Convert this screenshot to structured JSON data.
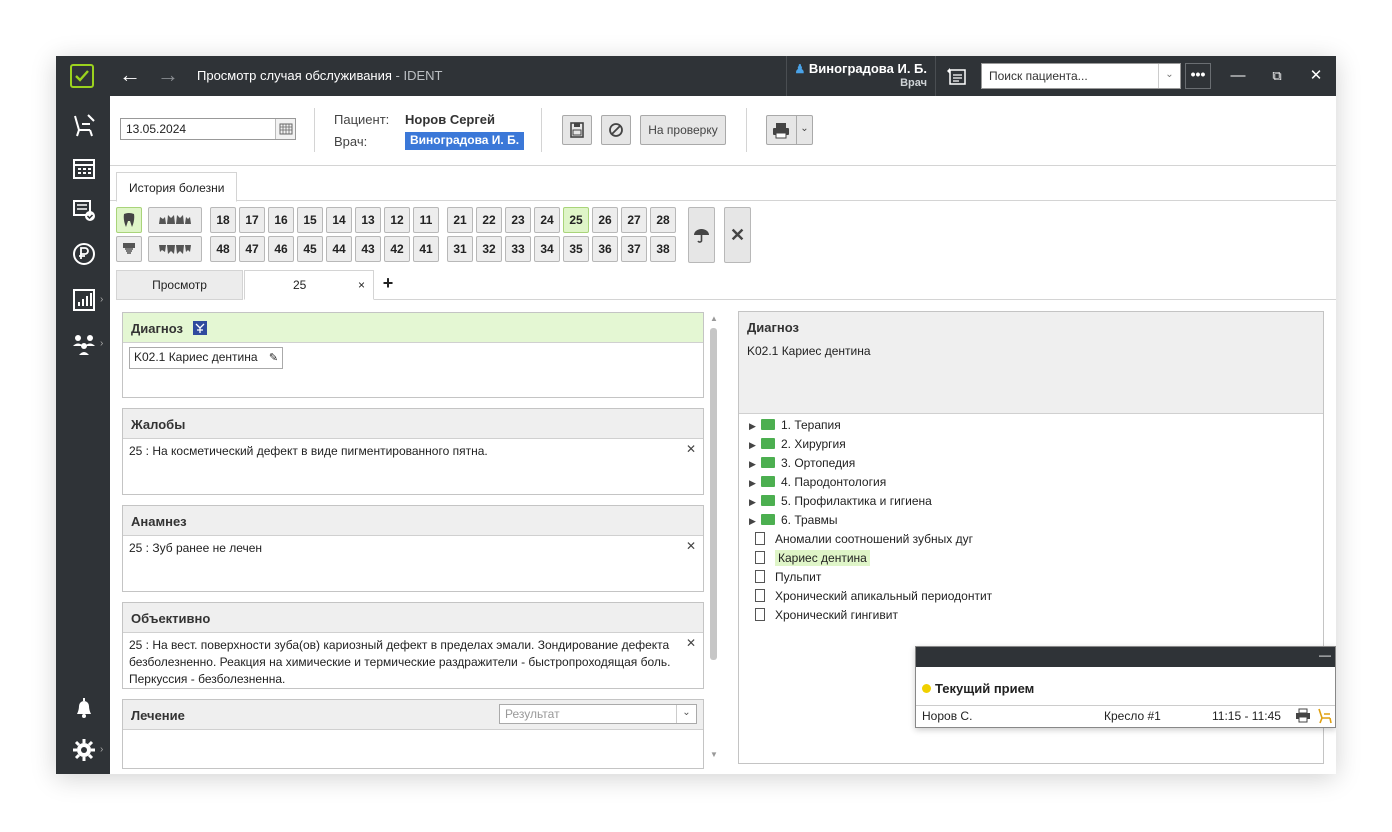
{
  "titlebar": {
    "page_title": "Просмотр случая обслуживания",
    "app_suffix": "- IDENT",
    "user_name": "Виноградова И. Б.",
    "user_role": "Врач",
    "search_placeholder": "Поиск пациента...",
    "more": "•••"
  },
  "toolbar": {
    "date": "13.05.2024",
    "patient_label": "Пациент:",
    "patient_name": "Норов Сергей",
    "doctor_label": "Врач:",
    "doctor_name": "Виноградова И. Б.",
    "review_label": "На проверку"
  },
  "tabs": {
    "history": "История болезни",
    "view": "Просмотр",
    "tooth_tab": "25",
    "close": "×",
    "add": "+"
  },
  "teeth": {
    "upper": [
      "18",
      "17",
      "16",
      "15",
      "14",
      "13",
      "12",
      "11",
      "21",
      "22",
      "23",
      "24",
      "25",
      "26",
      "27",
      "28"
    ],
    "lower": [
      "48",
      "47",
      "46",
      "45",
      "44",
      "43",
      "42",
      "41",
      "31",
      "32",
      "33",
      "34",
      "35",
      "36",
      "37",
      "38"
    ],
    "active": "25"
  },
  "panels": {
    "diagnosis": {
      "title": "Диагноз",
      "chip": "K02.1 Кариес дентина"
    },
    "complaints": {
      "title": "Жалобы",
      "text": "25 : На косметический дефект в виде пигментированного пятна."
    },
    "anamnesis": {
      "title": "Анамнез",
      "text": "25 : Зуб ранее не лечен"
    },
    "objective": {
      "title": "Объективно",
      "text": "25 : На вест. поверхности зуба(ов) кариозный дефект в пределах эмали. Зондирование дефекта безболезненно. Реакция на химические и термические раздражители - быстропроходящая боль. Перкуссия - безболезненна."
    },
    "treatment": {
      "title": "Лечение",
      "result_placeholder": "Результат"
    }
  },
  "right": {
    "title": "Диагноз",
    "value": "K02.1 Кариес дентина",
    "folders": [
      "1. Терапия",
      "2. Хирургия",
      "3. Ортопедия",
      "4. Пародонтология",
      "5. Профилактика и гигиена",
      "6. Травмы"
    ],
    "items": [
      "Аномалии соотношений зубных дуг",
      "Кариес дентина",
      "Пульпит",
      "Хронический апикальный периодонтит",
      "Хронический гингивит"
    ],
    "selected": "Кариес дентина"
  },
  "popup": {
    "title": "Текущий прием",
    "patient": "Норов С.",
    "chair": "Кресло #1",
    "time": "11:15 - 11:45",
    "minimize": "—"
  },
  "colors": {
    "accent_green": "#9bd21e",
    "selected_bg": "#dff5c8",
    "dark": "#2f3337",
    "doctor_highlight": "#3b78d8"
  }
}
